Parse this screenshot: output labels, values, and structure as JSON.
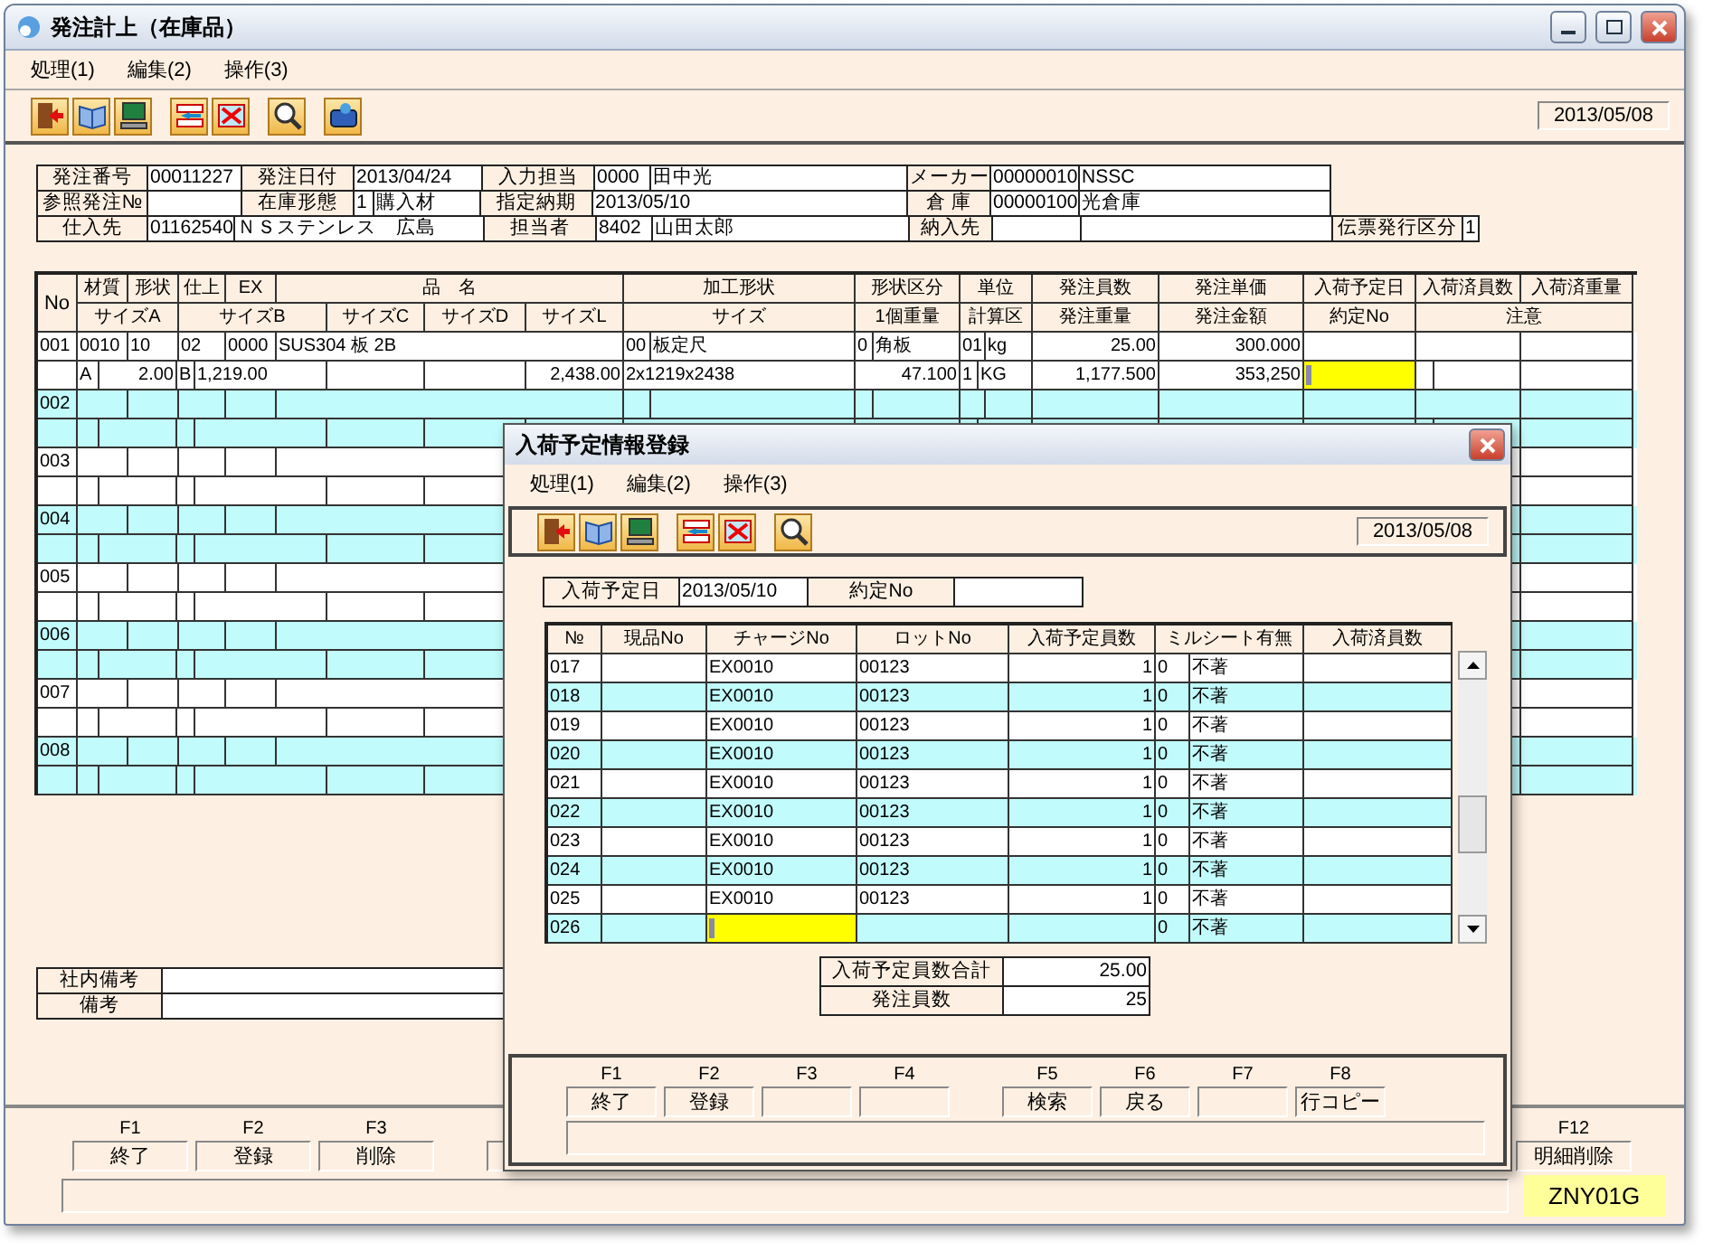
{
  "window": {
    "title": "発注計上（在庫品）"
  },
  "menu": [
    {
      "label": "処理(1)"
    },
    {
      "label": "編集(2)"
    },
    {
      "label": "操作(3)"
    }
  ],
  "toolbar": {
    "icons": [
      {
        "kind": "exit"
      },
      {
        "kind": "book"
      },
      {
        "kind": "computer"
      },
      {
        "kind": "insert"
      },
      {
        "kind": "delete"
      },
      {
        "kind": "search"
      },
      {
        "kind": "device"
      }
    ],
    "date": "2013/05/08"
  },
  "order_header": {
    "fields": [
      {
        "label": "発注番号",
        "values": [
          "00011227"
        ]
      },
      {
        "label": "発注日付",
        "values": [
          "2013/04/24"
        ]
      },
      {
        "label": "入力担当",
        "values": [
          "0000",
          "田中光"
        ]
      },
      {
        "label": "メーカー",
        "values": [
          "00000010",
          "NSSC"
        ]
      },
      {
        "label": "参照発注№"
      },
      {
        "label": "在庫形態",
        "values": [
          "1",
          "購入材"
        ]
      },
      {
        "label": "指定納期",
        "values": [
          "2013/05/10"
        ]
      },
      {
        "label": "倉 庫",
        "values": [
          "00000100",
          "光倉庫"
        ]
      },
      {
        "label": "仕入先",
        "values": [
          "01162540",
          "ＮＳステンレス　広島"
        ]
      },
      {
        "label": "担当者",
        "values": [
          "8402",
          "山田太郎"
        ]
      },
      {
        "label": "納入先"
      },
      {
        "label": "伝票発行区分",
        "values": [
          "1"
        ]
      }
    ]
  },
  "grid": {
    "no_header": "No",
    "header_rows": [
      [
        "材質",
        "形状",
        "仕上",
        "EX",
        "品　名",
        "加工形状",
        "形状区分",
        "単位",
        "発注員数",
        "発注単価",
        "入荷予定日",
        "入荷済員数",
        "入荷済重量"
      ],
      [
        "サイズA",
        "サイズB",
        "サイズC",
        "サイズD",
        "サイズL",
        "サイズ",
        "1個重量",
        "計算区",
        "発注重量",
        "発注金額",
        "約定No",
        "注意"
      ]
    ],
    "rows": [
      {
        "no": "001",
        "shaded": false,
        "lines": [
          {
            "cells": [
              {
                "text": "0010",
                "focused": false
              },
              {
                "text": "10",
                "focused": false
              },
              {
                "text": "02",
                "focused": false
              },
              {
                "text": "0000",
                "focused": false
              },
              {
                "text": "SUS304 板 2B",
                "focused": false
              },
              {
                "text": "00",
                "focused": false
              },
              {
                "text": "板定尺",
                "focused": false
              },
              {
                "text": "0",
                "focused": false
              },
              {
                "text": "角板",
                "focused": false
              },
              {
                "text": "01",
                "focused": false
              },
              {
                "text": "kg",
                "focused": false
              },
              {
                "text": "25.00",
                "focused": false
              },
              {
                "text": "300.000",
                "focused": false
              },
              {
                "focused": false
              },
              {
                "focused": false
              },
              {
                "focused": false
              }
            ]
          },
          {
            "cells": [
              {
                "text": "A",
                "focused": false
              },
              {
                "text": "2.00",
                "focused": false
              },
              {
                "text": "B",
                "focused": false
              },
              {
                "text": "1,219.00",
                "focused": false
              },
              {
                "focused": false
              },
              {
                "focused": false
              },
              {
                "text": "2,438.00",
                "focused": false
              },
              {
                "text": "2x1219x2438",
                "focused": false
              },
              {
                "text": "47.100",
                "focused": false
              },
              {
                "text": "1",
                "focused": false
              },
              {
                "text": "KG",
                "focused": false
              },
              {
                "text": "1,177.500",
                "focused": false
              },
              {
                "text": "353,250",
                "focused": false
              },
              {
                "focused": true
              },
              {
                "focused": false
              },
              {
                "focused": false
              },
              {
                "focused": false
              }
            ]
          }
        ]
      },
      {
        "no": "002",
        "shaded": true
      },
      {
        "no": "003",
        "shaded": false
      },
      {
        "no": "004",
        "shaded": true
      },
      {
        "no": "005",
        "shaded": false
      },
      {
        "no": "006",
        "shaded": true
      },
      {
        "no": "007",
        "shaded": false
      },
      {
        "no": "008",
        "shaded": true
      }
    ]
  },
  "notes": [
    {
      "label": "社内備考"
    },
    {
      "label": "備考"
    }
  ],
  "function_keys": [
    {
      "key": "F1",
      "label": "終了"
    },
    {
      "key": "F2",
      "label": "登録"
    },
    {
      "key": "F3",
      "label": "削除"
    },
    {
      "key": "F12",
      "label": "明細削除"
    }
  ],
  "screen_id": "ZNY01G",
  "dialog": {
    "title": "入荷予定情報登録",
    "menu": [
      {
        "label": "処理(1)"
      },
      {
        "label": "編集(2)"
      },
      {
        "label": "操作(3)"
      }
    ],
    "toolbar": {
      "icons": [
        {
          "kind": "exit"
        },
        {
          "kind": "book"
        },
        {
          "kind": "computer"
        },
        {
          "kind": "insert"
        },
        {
          "kind": "delete"
        },
        {
          "kind": "search"
        }
      ],
      "date": "2013/05/08"
    },
    "fields": [
      {
        "label": "入荷予定日",
        "value": "2013/05/10"
      },
      {
        "label": "約定No"
      }
    ],
    "table": {
      "columns": [
        "№",
        "現品No",
        "チャージNo",
        "ロットNo",
        "入荷予定員数",
        "ミルシート有無",
        "入荷済員数"
      ],
      "rows": [
        {
          "no": "017",
          "charge": "EX0010",
          "lot": "00123",
          "qty": "1",
          "mill_code": "0",
          "mill": "不著",
          "shaded": false,
          "focused": false
        },
        {
          "no": "018",
          "charge": "EX0010",
          "lot": "00123",
          "qty": "1",
          "mill_code": "0",
          "mill": "不著",
          "shaded": true,
          "focused": false
        },
        {
          "no": "019",
          "charge": "EX0010",
          "lot": "00123",
          "qty": "1",
          "mill_code": "0",
          "mill": "不著",
          "shaded": false,
          "focused": false
        },
        {
          "no": "020",
          "charge": "EX0010",
          "lot": "00123",
          "qty": "1",
          "mill_code": "0",
          "mill": "不著",
          "shaded": true,
          "focused": false
        },
        {
          "no": "021",
          "charge": "EX0010",
          "lot": "00123",
          "qty": "1",
          "mill_code": "0",
          "mill": "不著",
          "shaded": false,
          "focused": false
        },
        {
          "no": "022",
          "charge": "EX0010",
          "lot": "00123",
          "qty": "1",
          "mill_code": "0",
          "mill": "不著",
          "shaded": true,
          "focused": false
        },
        {
          "no": "023",
          "charge": "EX0010",
          "lot": "00123",
          "qty": "1",
          "mill_code": "0",
          "mill": "不著",
          "shaded": false,
          "focused": false
        },
        {
          "no": "024",
          "charge": "EX0010",
          "lot": "00123",
          "qty": "1",
          "mill_code": "0",
          "mill": "不著",
          "shaded": true,
          "focused": false
        },
        {
          "no": "025",
          "charge": "EX0010",
          "lot": "00123",
          "qty": "1",
          "mill_code": "0",
          "mill": "不著",
          "shaded": false,
          "focused": false
        },
        {
          "no": "026",
          "mill_code": "0",
          "mill": "不著",
          "shaded": true,
          "focused": true
        }
      ]
    },
    "totals": [
      {
        "label": "入荷予定員数合計",
        "value": "25.00"
      },
      {
        "label": "発注員数",
        "value": "25"
      }
    ],
    "function_keys": [
      {
        "key": "F1",
        "label": "終了"
      },
      {
        "key": "F2",
        "label": "登録"
      },
      {
        "key": "F3"
      },
      {
        "key": "F4"
      },
      {
        "key": "F5",
        "label": "検索"
      },
      {
        "key": "F6",
        "label": "戻る"
      },
      {
        "key": "F7"
      },
      {
        "key": "F8",
        "label": "行コピー"
      }
    ]
  }
}
